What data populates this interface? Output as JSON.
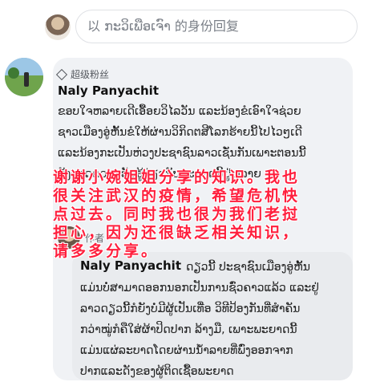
{
  "reply": {
    "placeholder": "以 ກະວິເພືອເຈົາ 的身份回复"
  },
  "comment": {
    "badge": "超级粉丝",
    "author": "Naly Panyachit",
    "lines": [
      "ຂອບໃຈຫລາຍເດີເອື້ອຍວິໄລວັນ  ແລະນ້ອງຂໍເອົາໃຈຊ່ວຍ",
      "ຊາວເມືອງອູ່ຫັ້ນຂໍໃຫ້ຜ່ານວິກິດຕສີໂລກຮ້າຍນີ້ໄປໄວໆເດີ",
      "ແລະນ້ອງກະເປັນຫ່ວງປະຊາຊົນລາວເຊັ່ນກັນເພາະຕອນນີ້",
      "ຍັງຂາດຄວາມຮັບຮູ້ກ່ຽວກັບພະຍາດນີ້ຢູ່ຫລາຍ"
    ]
  },
  "nested": {
    "label": "作者",
    "author": "Naly Panyachit",
    "lines": [
      "ດຽວນີ້ ປະຊາຊົນເມືອງອູ່ຫັ້ນ",
      "ແມ່ນບໍ່ສາມາດອອກນອກເປັນການຊົ່ວຄາວແລ້ວ ແລະຢູ່",
      "ລາວດຽວນີ້ກໍຍັງບໍ່ມີຜູ້ເປັນເທື່ອ ວິທີປ້ອງກັນທີ່ສຳຄັນ",
      "ກວ່າໝູ່ກໍຄືໃສ່ຜ້າປິດປາກ ລ້າງມື, ເພາະພະຍາດນີ້",
      "ແມ່ນແຜ່ລະບາດໂດຍຜ່ານນ້ຳລາຍທີ່ພົ່ງອອກຈາກ",
      "ປາກແລະດັງຂອງຜູ້ຕິດເຊື້ອພະຍາດ"
    ]
  },
  "overlay": {
    "lines": [
      "谢谢小婉姐姐分享的知识。我也",
      "很关注武汉的疫情，希望危机快",
      "点过去。同时我也很为我们老挝",
      "担心，因为还很缺乏相关知识，",
      "请多多分享。"
    ]
  },
  "colors": {
    "bubble": "#f0f2f5",
    "overlay_text": "#ff1f3d"
  }
}
